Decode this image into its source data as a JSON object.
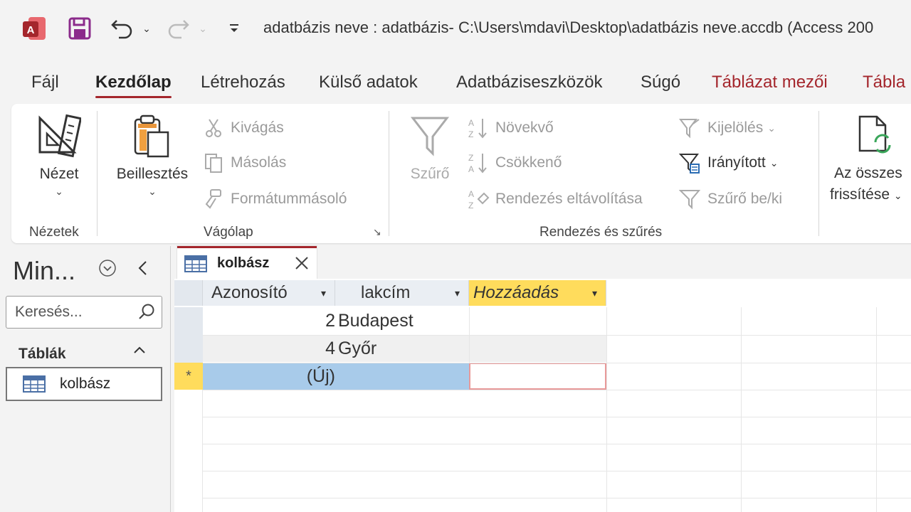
{
  "titlebar": {
    "title": "adatbázis neve : adatbázis- C:\\Users\\mdavi\\Desktop\\adatbázis neve.accdb (Access 200"
  },
  "tabs": [
    "Fájl",
    "Kezdőlap",
    "Létrehozás",
    "Külső adatok",
    "Adatbáziseszközök",
    "Súgó",
    "Táblázat mezői",
    "Tábla"
  ],
  "ribbon": {
    "views": {
      "nezet": "Nézet",
      "label": "Nézetek"
    },
    "clipboard": {
      "paste": "Beillesztés",
      "cut": "Kivágás",
      "copy": "Másolás",
      "format_painter": "Formátummásoló",
      "label": "Vágólap"
    },
    "sortfilter": {
      "filter": "Szűrő",
      "ascending": "Növekvő",
      "descending": "Csökkenő",
      "remove_sort": "Rendezés eltávolítása",
      "selection": "Kijelölés",
      "advanced": "Irányított",
      "toggle_filter": "Szűrő be/ki",
      "label": "Rendezés és szűrés"
    },
    "records": {
      "refresh_line1": "Az összes",
      "refresh_line2": "frissítése"
    }
  },
  "nav": {
    "title": "Min...",
    "search_placeholder": "Keresés...",
    "section": "Táblák",
    "items": [
      "kolbász"
    ]
  },
  "document": {
    "tab_title": "kolbász",
    "columns": [
      "Azonosító",
      "lakcím",
      "Hozzáadás"
    ],
    "rows": [
      {
        "id": "2",
        "lakcim": "Budapest"
      },
      {
        "id": "4",
        "lakcim": "Győr"
      }
    ],
    "new_row_label": "(Új)",
    "new_row_marker": "*"
  },
  "colors": {
    "accent": "#a4262c",
    "add_column": "#ffdc5c",
    "new_row_select": "#a8cbea"
  }
}
